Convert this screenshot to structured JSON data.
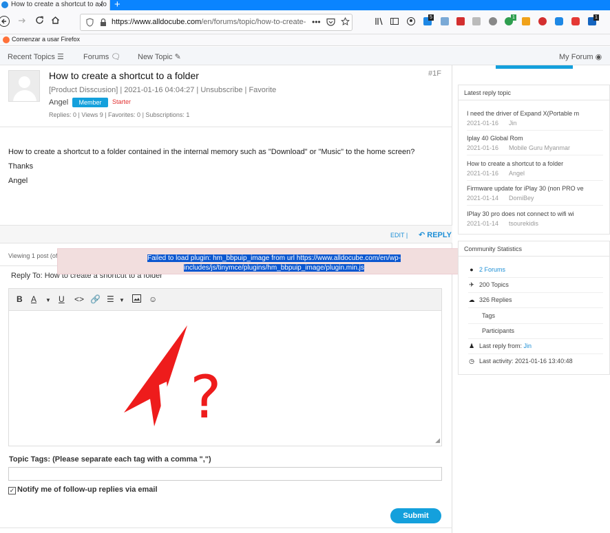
{
  "browser": {
    "tab_title": "How to create a shortcut to a fo",
    "tab_close": "×",
    "new_tab": "+",
    "url_host": "https://www.alldocube.com",
    "url_path": "/en/forums/topic/how-to-create-a",
    "url_more": "•••",
    "bookmark_label": "Comenzar a usar Firefox",
    "badges": {
      "pocket": "5",
      "green": "1",
      "ext": "1"
    }
  },
  "site_nav": {
    "recent_topics": "Recent Topics",
    "forums": "Forums",
    "new_topic": "New Topic",
    "my_forum": "My Forum"
  },
  "post": {
    "title": "How to create a shortcut to a folder",
    "number": "#1F",
    "meta": "[Product Disscusion] | 2021-01-16 04:04:27 | Unsubscribe | Favorite",
    "author": "Angel",
    "role": "Member",
    "starter": "Starter",
    "stats": "Replies: 0 | Views 9 | Favorites: 0 | Subscriptions: 1",
    "body": [
      "How to create a shortcut to a folder contained in the internal memory such as \"Download\" or \"Music\" to the home screen?",
      "Thanks",
      "Angel"
    ],
    "edit": "EDIT |",
    "reply": "REPLY"
  },
  "viewing": "Viewing 1 post (of 1 total)",
  "reply_form": {
    "reply_to": "Reply To: How to create a shortcut to a folder",
    "error": "Failed to load plugin: hm_bbpuip_image from url https://www.alldocube.com/en/wp-includes/js/tinymce/plugins/hm_bbpuip_image/plugin.min.js",
    "error_close": "×",
    "annotation": "?",
    "tags_label": "Topic Tags: (Please separate each tag with a comma \",\")",
    "tags_value": "",
    "notify_label": "Notify me of follow-up replies via email",
    "notify_checked": true,
    "submit": "Submit"
  },
  "sidebar": {
    "latest_reply": {
      "header": "Latest reply topic",
      "items": [
        {
          "title": "I need the driver of Expand X(Portable m",
          "date": "2021-01-16",
          "user": "Jin"
        },
        {
          "title": "Iplay 40 Global Rom",
          "date": "2021-01-16",
          "user": "Mobile Guru Myanmar"
        },
        {
          "title": "How to create a shortcut to a folder",
          "date": "2021-01-16",
          "user": "Angel"
        },
        {
          "title": "Firmware update for iPlay 30 (non PRO ve",
          "date": "2021-01-14",
          "user": "DomiBey"
        },
        {
          "title": "IPlay 30 pro does not connect to wifi wi",
          "date": "2021-01-14",
          "user": "tsourekidis"
        }
      ]
    },
    "community": {
      "header": "Community Statistics",
      "forums_num": "2",
      "forums_label": "Forums",
      "topics_num": "200",
      "topics_label": "Topics",
      "replies_num": "326",
      "replies_label": "Replies",
      "tags_label": "Tags",
      "participants_label": "Participants",
      "last_reply_label": "Last reply from:",
      "last_reply_user": "Jin",
      "last_activity": "Last activity: 2021-01-16 13:40:48"
    }
  },
  "colors": {
    "accent": "#14a0dc",
    "firefox_blue": "#0a84ff",
    "error_bg": "#f2dede",
    "annotation": "#ee1c1c"
  }
}
